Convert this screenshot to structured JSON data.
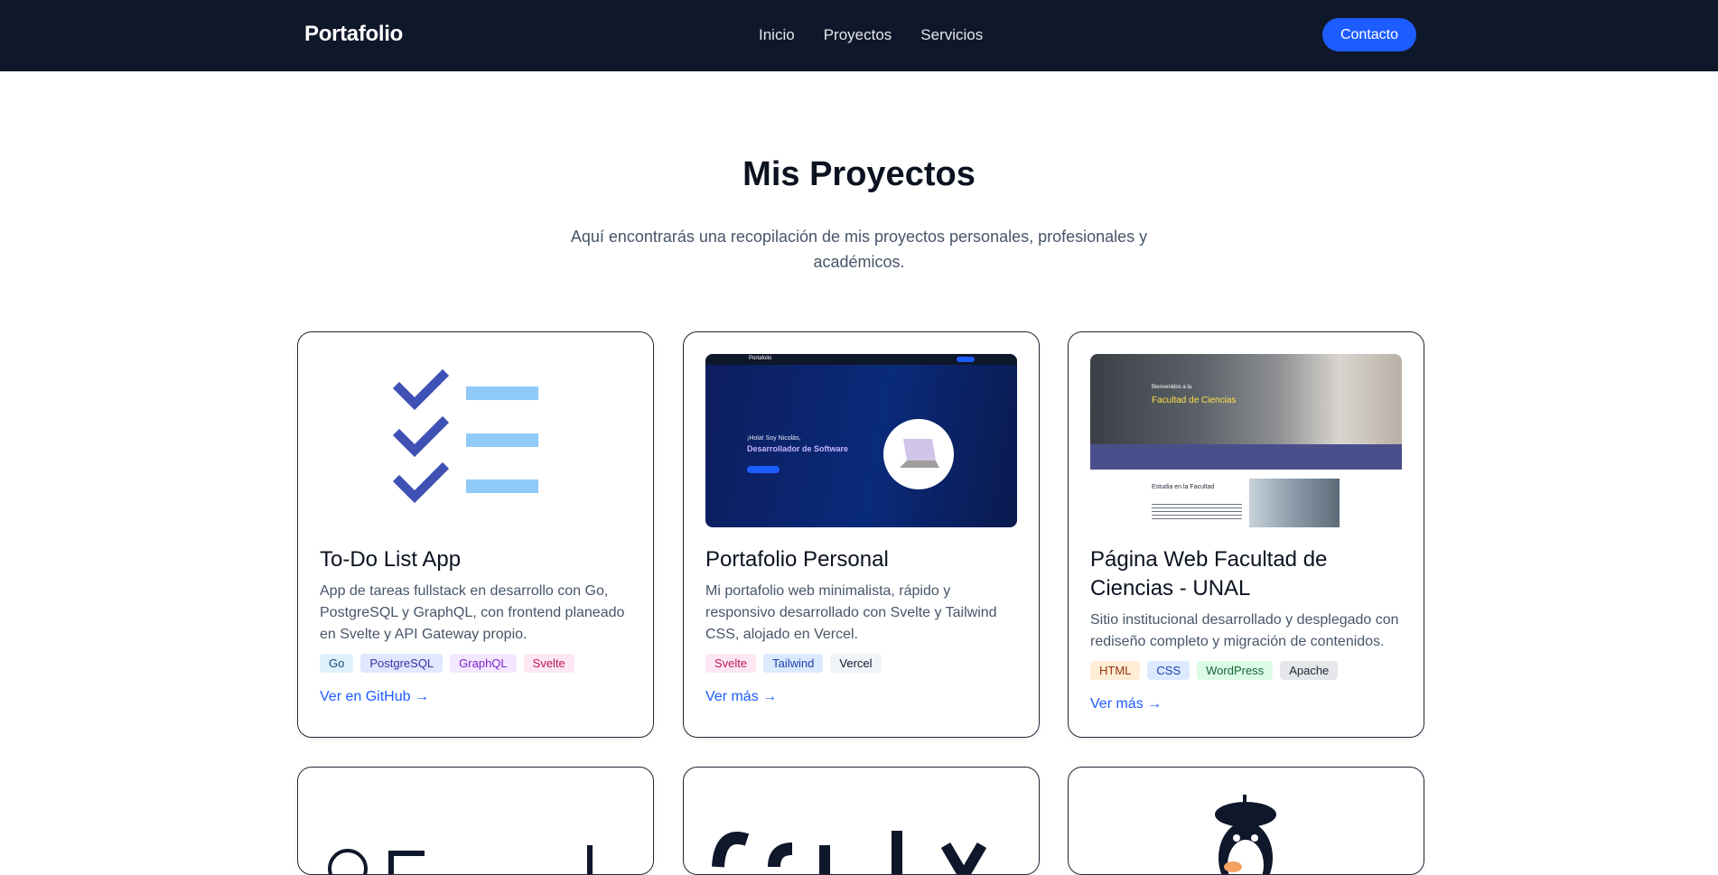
{
  "navbar": {
    "brand": "Portafolio",
    "links": [
      "Inicio",
      "Proyectos",
      "Servicios"
    ],
    "contact_label": "Contacto"
  },
  "header": {
    "title": "Mis Proyectos",
    "subtitle": "Aquí encontrarás una recopilación de mis proyectos personales, profesionales y académicos."
  },
  "projects": [
    {
      "title": "To-Do List App",
      "description": "App de tareas fullstack en desarrollo con Go, PostgreSQL y GraphQL, con frontend planeado en Svelte y API Gateway propio.",
      "tags": [
        "Go",
        "PostgreSQL",
        "GraphQL",
        "Svelte"
      ],
      "link": "Ver en GitHub →",
      "image_icon": "checklist-icon"
    },
    {
      "title": "Portafolio Personal",
      "description": "Mi portafolio web minimalista, rápido y responsivo desarrollado con Svelte y Tailwind CSS, alojado en Vercel.",
      "tags": [
        "Svelte",
        "Tailwind",
        "Vercel"
      ],
      "link": "Ver más →",
      "preview": {
        "brand": "Portafolio",
        "greeting": "¡Hola! Soy Nicolás,",
        "headline": "Desarrollador de Software"
      }
    },
    {
      "title": "Página Web Facultad de Ciencias - UNAL",
      "description": "Sitio institucional desarrollado y desplegado con rediseño completo y migración de contenidos.",
      "tags": [
        "HTML",
        "CSS",
        "WordPress",
        "Apache"
      ],
      "link": "Ver más →",
      "preview": {
        "welcome": "Bienvenidos a la",
        "headline": "Facultad de Ciencias",
        "section": "Estudia en la Facultad"
      }
    }
  ],
  "tag_colors": {
    "Go": [
      "#e0f2fe",
      "#0c4a6e"
    ],
    "PostgreSQL": [
      "#e0e7ff",
      "#3730a3"
    ],
    "GraphQL": [
      "#f3e8ff",
      "#7e22ce"
    ],
    "Svelte": [
      "#fce7f3",
      "#be185d"
    ],
    "Tailwind": [
      "#dbeafe",
      "#1e40af"
    ],
    "Vercel": [
      "#f1f5f9",
      "#0f172a"
    ],
    "HTML": [
      "#ffedd5",
      "#9a3412"
    ],
    "CSS": [
      "#dbeafe",
      "#1e40af"
    ],
    "WordPress": [
      "#dcfce7",
      "#166534"
    ],
    "Apache": [
      "#e5e7eb",
      "#1f2937"
    ]
  },
  "colors": {
    "nav_bg": "#0f172a",
    "accent": "#1d5cff",
    "check_blue": "#3f51b5",
    "line_blue": "#90caf9"
  }
}
